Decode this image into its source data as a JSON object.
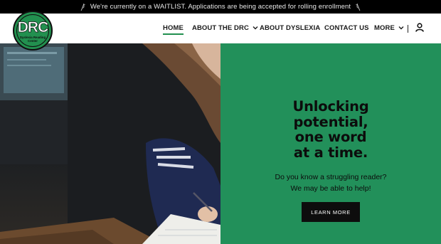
{
  "announcement": {
    "text": "We're currently on a WAITLIST. Applications are being accepted for rolling enrollment",
    "icon": "wheat-sprig-icon"
  },
  "logo": {
    "mark": "DRC",
    "subtitle_line1": "Dyslexia Reading",
    "subtitle_line2": "Center"
  },
  "nav": {
    "items": [
      {
        "label": "HOME",
        "active": true
      },
      {
        "label": "ABOUT THE DRC",
        "dropdown": true
      },
      {
        "label": "ABOUT DYSLEXIA"
      },
      {
        "label": "CONTACT US"
      },
      {
        "label": "MORE",
        "dropdown": true
      }
    ],
    "account_icon": "user-icon"
  },
  "hero": {
    "headline_lines": [
      "Unlocking",
      "potential,",
      "one word",
      "at a time."
    ],
    "tagline_lines": [
      "Do you know a struggling reader?",
      "We may be able to help!"
    ],
    "cta_label": "LEARN MORE",
    "photo_alt": "child-writing-photo"
  },
  "colors": {
    "brand_green": "#22905a",
    "announcement_bg": "#000000",
    "cta_bg": "#0d0d0d"
  }
}
